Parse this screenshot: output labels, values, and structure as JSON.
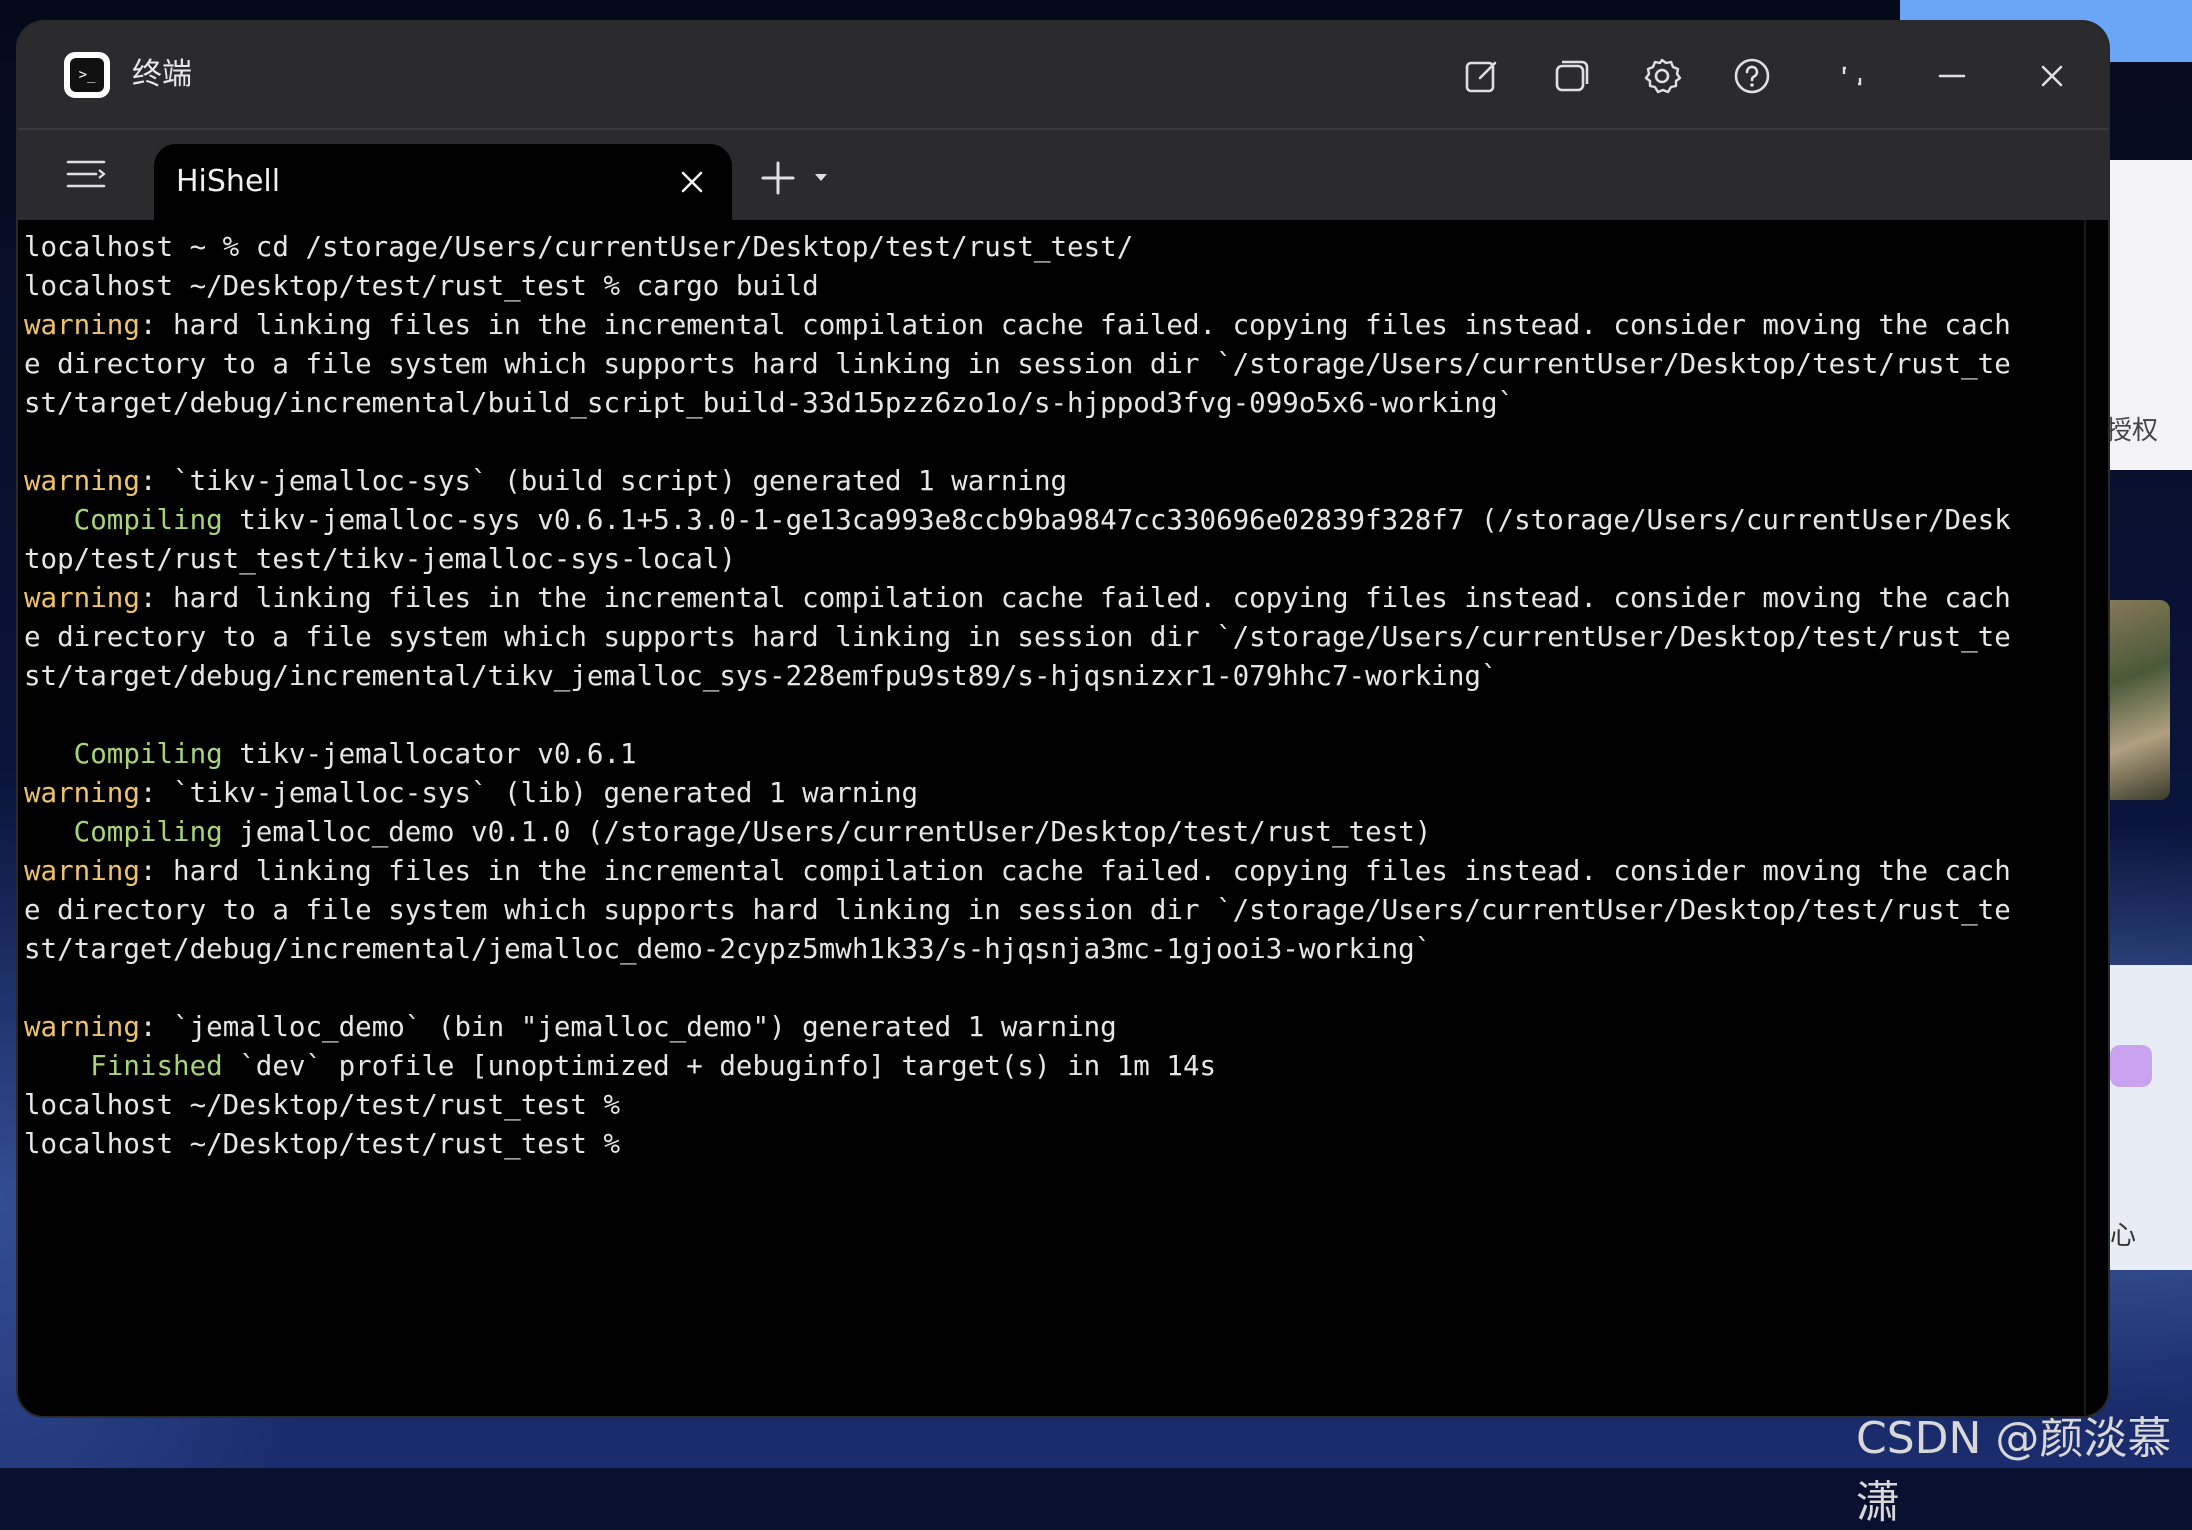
{
  "window": {
    "title": "终端"
  },
  "titlebar": {
    "icons": [
      "edit-icon",
      "window-copy-icon",
      "settings-icon",
      "help-icon",
      "restore-icon",
      "minimize-icon",
      "close-icon"
    ]
  },
  "tabs": [
    {
      "label": "HiShell"
    }
  ],
  "terminal": {
    "lines": [
      [
        {
          "text": "localhost ~ % cd /storage/Users/currentUser/Desktop/test/rust_test/",
          "c": "n"
        }
      ],
      [
        {
          "text": "localhost ~/Desktop/test/rust_test % cargo build",
          "c": "n"
        }
      ],
      [
        {
          "text": "warning",
          "c": "w"
        },
        {
          "text": ": hard linking files in the incremental compilation cache failed. copying files instead. consider moving the cach",
          "c": "n"
        }
      ],
      [
        {
          "text": "e directory to a file system which supports hard linking in session dir `/storage/Users/currentUser/Desktop/test/rust_te",
          "c": "n"
        }
      ],
      [
        {
          "text": "st/target/debug/incremental/build_script_build-33d15pzz6zo1o/s-hjppod3fvg-099o5x6-working`",
          "c": "n"
        }
      ],
      [
        {
          "text": "",
          "c": "n"
        }
      ],
      [
        {
          "text": "warning",
          "c": "w"
        },
        {
          "text": ": `tikv-jemalloc-sys` (build script) generated 1 warning",
          "c": "n"
        }
      ],
      [
        {
          "text": "   Compiling",
          "c": "g"
        },
        {
          "text": " tikv-jemalloc-sys v0.6.1+5.3.0-1-ge13ca993e8ccb9ba9847cc330696e02839f328f7 (/storage/Users/currentUser/Desk",
          "c": "n"
        }
      ],
      [
        {
          "text": "top/test/rust_test/tikv-jemalloc-sys-local)",
          "c": "n"
        }
      ],
      [
        {
          "text": "warning",
          "c": "w"
        },
        {
          "text": ": hard linking files in the incremental compilation cache failed. copying files instead. consider moving the cach",
          "c": "n"
        }
      ],
      [
        {
          "text": "e directory to a file system which supports hard linking in session dir `/storage/Users/currentUser/Desktop/test/rust_te",
          "c": "n"
        }
      ],
      [
        {
          "text": "st/target/debug/incremental/tikv_jemalloc_sys-228emfpu9st89/s-hjqsnizxr1-079hhc7-working`",
          "c": "n"
        }
      ],
      [
        {
          "text": "",
          "c": "n"
        }
      ],
      [
        {
          "text": "   Compiling",
          "c": "g"
        },
        {
          "text": " tikv-jemallocator v0.6.1",
          "c": "n"
        }
      ],
      [
        {
          "text": "warning",
          "c": "w"
        },
        {
          "text": ": `tikv-jemalloc-sys` (lib) generated 1 warning",
          "c": "n"
        }
      ],
      [
        {
          "text": "   Compiling",
          "c": "g"
        },
        {
          "text": " jemalloc_demo v0.1.0 (/storage/Users/currentUser/Desktop/test/rust_test)",
          "c": "n"
        }
      ],
      [
        {
          "text": "warning",
          "c": "w"
        },
        {
          "text": ": hard linking files in the incremental compilation cache failed. copying files instead. consider moving the cach",
          "c": "n"
        }
      ],
      [
        {
          "text": "e directory to a file system which supports hard linking in session dir `/storage/Users/currentUser/Desktop/test/rust_te",
          "c": "n"
        }
      ],
      [
        {
          "text": "st/target/debug/incremental/jemalloc_demo-2cypz5mwh1k33/s-hjqsnja3mc-1gjooi3-working`",
          "c": "n"
        }
      ],
      [
        {
          "text": "",
          "c": "n"
        }
      ],
      [
        {
          "text": "warning",
          "c": "w"
        },
        {
          "text": ": `jemalloc_demo` (bin \"jemalloc_demo\") generated 1 warning",
          "c": "n"
        }
      ],
      [
        {
          "text": "    Finished",
          "c": "g"
        },
        {
          "text": " `dev` profile [unoptimized + debuginfo] target(s) in 1m 14s",
          "c": "n"
        }
      ],
      [
        {
          "text": "localhost ~/Desktop/test/rust_test %",
          "c": "n"
        }
      ],
      [
        {
          "text": "localhost ~/Desktop/test/rust_test %",
          "c": "n"
        }
      ]
    ]
  },
  "desktop": {
    "side_label_top": "授权",
    "side_label_bottom": "心",
    "watermark": "CSDN @颜淡慕潇"
  },
  "colors": {
    "warning": "#f0c36a",
    "compiling": "#a7d379",
    "text": "#e6e6e6",
    "titlebar": "#2b2b2d"
  }
}
